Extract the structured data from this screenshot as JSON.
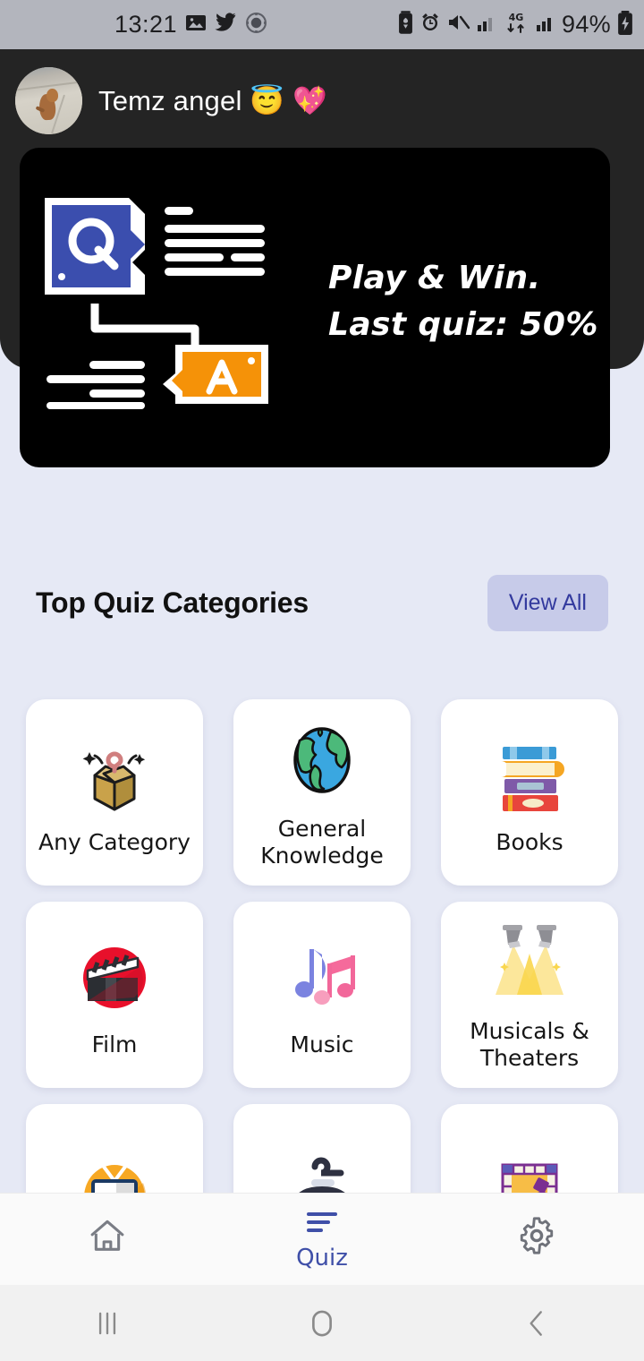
{
  "status_bar": {
    "time": "13:21",
    "battery_percent": "94%",
    "left_icons": [
      "photo-icon",
      "twitter-icon",
      "app-badge-icon"
    ],
    "right_icons": [
      "battery-saver-icon",
      "alarm-icon",
      "mute-icon",
      "signal-bars-icon",
      "4g-data-icon",
      "signal-bars-2-icon",
      "charging-battery-icon"
    ]
  },
  "header": {
    "username": "Temz angel 😇 💖",
    "avatar_alt": "user-avatar-dog-photo"
  },
  "banner": {
    "line1": "Play & Win.",
    "line2": "Last quiz: 50%",
    "last_quiz_score": "50%",
    "art": {
      "question_letter": "Q",
      "answer_letter": "A",
      "question_color": "#3b4eae",
      "answer_color": "#f59208"
    }
  },
  "section": {
    "title": "Top Quiz Categories",
    "view_all_label": "View All"
  },
  "categories": [
    {
      "label": "Any Category",
      "icon": "mystery-box-icon"
    },
    {
      "label": "General Knowledge",
      "icon": "globe-icon"
    },
    {
      "label": "Books",
      "icon": "book-stack-icon"
    },
    {
      "label": "Film",
      "icon": "clapperboard-icon"
    },
    {
      "label": "Music",
      "icon": "music-notes-icon"
    },
    {
      "label": "Musicals & Theaters",
      "icon": "spotlights-icon"
    },
    {
      "label": "",
      "icon": "television-icon"
    },
    {
      "label": "",
      "icon": "game-controller-icon"
    },
    {
      "label": "",
      "icon": "board-game-icon"
    }
  ],
  "bottom_nav": [
    {
      "label": "",
      "icon": "home-icon",
      "active": false
    },
    {
      "label": "Quiz",
      "icon": "quiz-list-icon",
      "active": true
    },
    {
      "label": "",
      "icon": "gear-icon",
      "active": false
    }
  ],
  "system_nav": [
    {
      "icon": "recents-icon"
    },
    {
      "icon": "home-circle-icon"
    },
    {
      "icon": "back-icon"
    }
  ],
  "colors": {
    "background": "#e6e9f5",
    "header_dark": "#242424",
    "banner_black": "#000000",
    "accent_blue": "#3f4fa8",
    "view_all_bg": "#c7cbe9",
    "view_all_text": "#333a9e",
    "card_white": "#ffffff"
  }
}
